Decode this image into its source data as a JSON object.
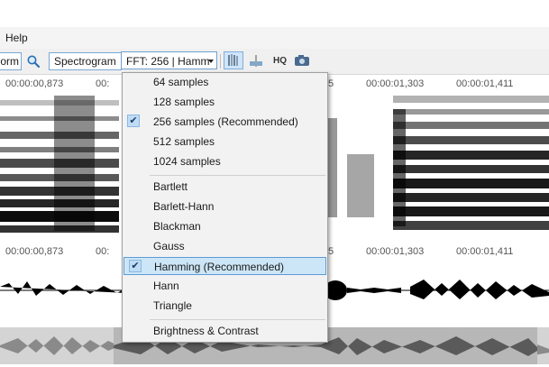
{
  "menubar": {
    "help": "Help"
  },
  "toolbar": {
    "view_mode_partial": "orm",
    "spectrogram_label": "Spectrogram",
    "fft_selector_value": "FFT: 256 | Hamm",
    "hq_label": "HQ"
  },
  "timeline_top": [
    "00:00:00,873",
    "00:",
    "5",
    "00:00:01,303",
    "00:00:01,411"
  ],
  "timeline_bottom": [
    "00:00:00,873",
    "00:",
    "5",
    "00:00:01,303",
    "00:00:01,411"
  ],
  "fft_menu": {
    "sample_items": [
      {
        "label": "64 samples",
        "checked": false
      },
      {
        "label": "128 samples",
        "checked": false
      },
      {
        "label": "256 samples (Recommended)",
        "checked": true
      },
      {
        "label": "512 samples",
        "checked": false
      },
      {
        "label": "1024 samples",
        "checked": false
      }
    ],
    "window_items": [
      {
        "label": "Bartlett",
        "checked": false
      },
      {
        "label": "Barlett-Hann",
        "checked": false
      },
      {
        "label": "Blackman",
        "checked": false
      },
      {
        "label": "Gauss",
        "checked": false
      },
      {
        "label": "Hamming (Recommended)",
        "checked": true,
        "highlighted": true
      },
      {
        "label": "Hann",
        "checked": false
      },
      {
        "label": "Triangle",
        "checked": false
      }
    ],
    "extra_item": "Brightness & Contrast"
  }
}
